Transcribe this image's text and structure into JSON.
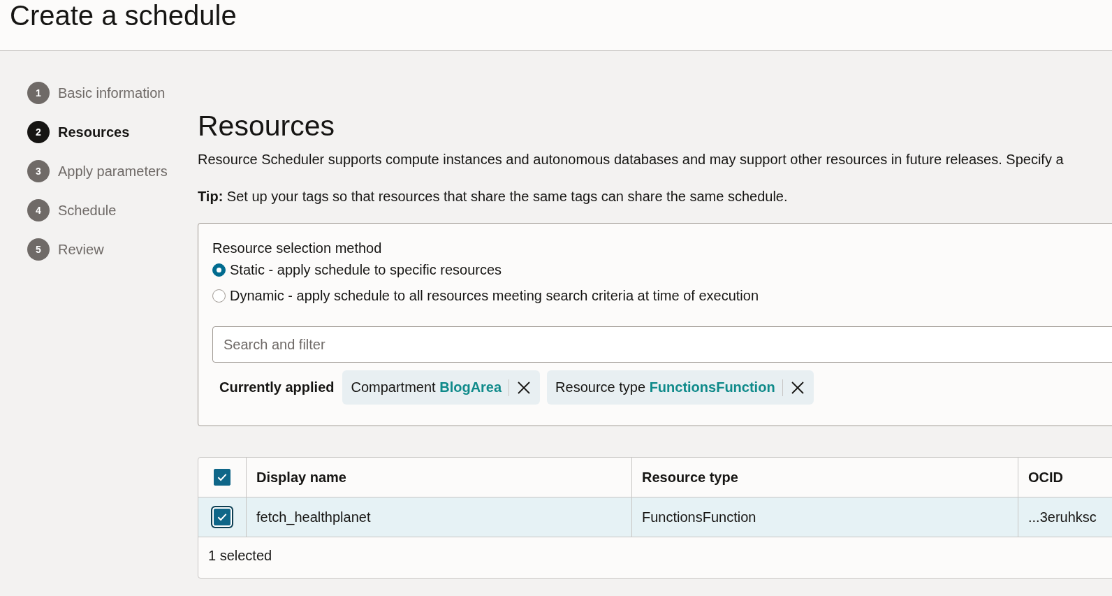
{
  "page_title": "Create a schedule",
  "steps": [
    {
      "number": "1",
      "label": "Basic information",
      "selected": false
    },
    {
      "number": "2",
      "label": "Resources",
      "selected": true
    },
    {
      "number": "3",
      "label": "Apply parameters",
      "selected": false
    },
    {
      "number": "4",
      "label": "Schedule",
      "selected": false
    },
    {
      "number": "5",
      "label": "Review",
      "selected": false
    }
  ],
  "section_title": "Resources",
  "description": "Resource Scheduler supports compute instances and autonomous databases and may support other resources in future releases. Specify a",
  "tip": "**Tip:** Set up your tags so that resources that share the same tags can share the same schedule.",
  "selection_method": {
    "label": "Resource selection method",
    "options": [
      {
        "label": "Static - apply schedule to specific resources",
        "selected": true
      },
      {
        "label": "Dynamic - apply schedule to all resources meeting search criteria at time of execution",
        "selected": false
      }
    ]
  },
  "search": {
    "placeholder": "Search and filter"
  },
  "filters": {
    "label": "Currently applied",
    "chips": [
      {
        "text": "Compartment **BlogArea**"
      },
      {
        "text": "Resource type **FunctionsFunction**"
      }
    ]
  },
  "table": {
    "all_checked": true,
    "columns": [
      "Display name",
      "Resource type",
      "OCID"
    ],
    "rows": [
      {
        "selected": true,
        "cells": [
          "fetch_healthplanet",
          "FunctionsFunction",
          "...3eruhksc"
        ]
      }
    ],
    "footer": "1 selected"
  }
}
